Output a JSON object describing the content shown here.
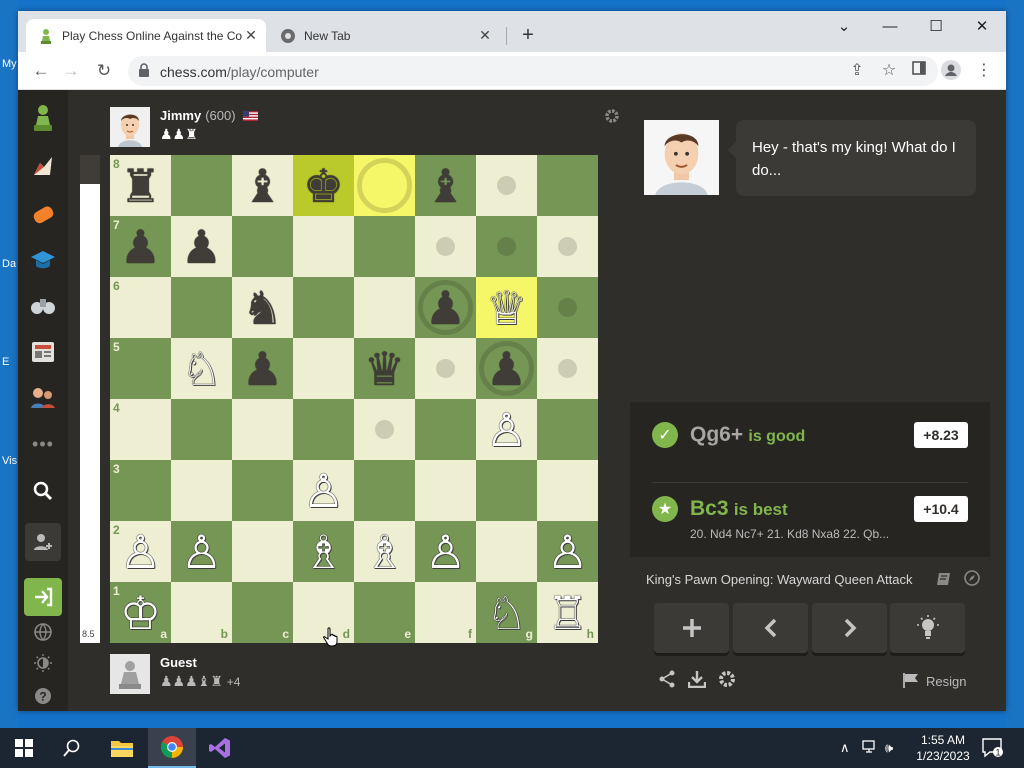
{
  "desktop": {
    "fragments": [
      "My",
      "Da",
      "E",
      "Vis"
    ]
  },
  "browser": {
    "tabs": [
      {
        "title": "Play Chess Online Against the Computer",
        "active": true
      },
      {
        "title": "New Tab",
        "active": false
      }
    ],
    "window_controls": {
      "dropdown": "⌄",
      "minimize": "—",
      "maximize": "☐",
      "close": "✕"
    },
    "url": {
      "host": "chess.com",
      "path": "/play/computer"
    }
  },
  "sidebar": {
    "items": [
      "chess-com-logo",
      "puzzles",
      "play",
      "learn",
      "watch",
      "news",
      "social",
      "more",
      "search",
      "add-friend",
      "log-in",
      "language",
      "theme",
      "help"
    ]
  },
  "opponent": {
    "name": "Jimmy",
    "rating": "(600)",
    "flag": "us-flag",
    "captured": "♟♟♜"
  },
  "player": {
    "name": "Guest",
    "captured": "♟♟♟♝♜",
    "advantage": "+4"
  },
  "evaluation": {
    "label": "8.5",
    "white_fraction": 0.94
  },
  "board": {
    "coordinates": {
      "ranks": [
        "8",
        "7",
        "6",
        "5",
        "4",
        "3",
        "2",
        "1"
      ],
      "files": [
        "a",
        "b",
        "c",
        "d",
        "e",
        "f",
        "g",
        "h"
      ]
    },
    "pieces": [
      {
        "sq": "a8",
        "p": "♜",
        "c": "b"
      },
      {
        "sq": "c8",
        "p": "♝",
        "c": "b"
      },
      {
        "sq": "d8",
        "p": "♚",
        "c": "b"
      },
      {
        "sq": "f8",
        "p": "♝",
        "c": "b"
      },
      {
        "sq": "a7",
        "p": "♟",
        "c": "b"
      },
      {
        "sq": "b7",
        "p": "♟",
        "c": "b"
      },
      {
        "sq": "c6",
        "p": "♞",
        "c": "b"
      },
      {
        "sq": "f6",
        "p": "♟",
        "c": "b"
      },
      {
        "sq": "g6",
        "p": "♕",
        "c": "w"
      },
      {
        "sq": "b5",
        "p": "♘",
        "c": "w"
      },
      {
        "sq": "c5",
        "p": "♟",
        "c": "b"
      },
      {
        "sq": "e5",
        "p": "♛",
        "c": "b"
      },
      {
        "sq": "g5",
        "p": "♟",
        "c": "b"
      },
      {
        "sq": "g4",
        "p": "♙",
        "c": "w"
      },
      {
        "sq": "d3",
        "p": "♙",
        "c": "w"
      },
      {
        "sq": "a2",
        "p": "♙",
        "c": "w"
      },
      {
        "sq": "b2",
        "p": "♙",
        "c": "w"
      },
      {
        "sq": "d2",
        "p": "♗",
        "c": "w"
      },
      {
        "sq": "e2",
        "p": "♗",
        "c": "w"
      },
      {
        "sq": "f2",
        "p": "♙",
        "c": "w"
      },
      {
        "sq": "h2",
        "p": "♙",
        "c": "w"
      },
      {
        "sq": "a1",
        "p": "♔",
        "c": "w"
      },
      {
        "sq": "g1",
        "p": "♘",
        "c": "w"
      },
      {
        "sq": "h1",
        "p": "♖",
        "c": "w"
      }
    ],
    "highlight_squares": [
      "e8",
      "d8",
      "g6"
    ],
    "move_dots": [
      "g8",
      "f7",
      "g7",
      "h7",
      "h6",
      "f5",
      "h5",
      "e4"
    ],
    "capture_rings": [
      "e8",
      "f6",
      "g5"
    ]
  },
  "coach": {
    "message": "Hey - that's my king! What do I do..."
  },
  "analysis": {
    "played": {
      "san": "Qg6+",
      "verdict": "is good",
      "score": "+8.23"
    },
    "best": {
      "san": "Bc3",
      "verdict": "is best",
      "score": "+10.4",
      "line": "20. Nd4 Nc7+ 21. Kd8 Nxa8 22. Qb..."
    }
  },
  "opening": "King's Pawn Opening: Wayward Queen Attack",
  "controls": {
    "resign_label": "Resign"
  },
  "taskbar": {
    "time": "1:55 AM",
    "date": "1/23/2023",
    "notifications": "1"
  },
  "colors": {
    "light_square": "#eeeed2",
    "dark_square": "#769656",
    "highlight_light": "#f6f669",
    "highlight_dark": "#baca2b",
    "good_green": "#81b64c",
    "best_green": "#81b64c"
  }
}
